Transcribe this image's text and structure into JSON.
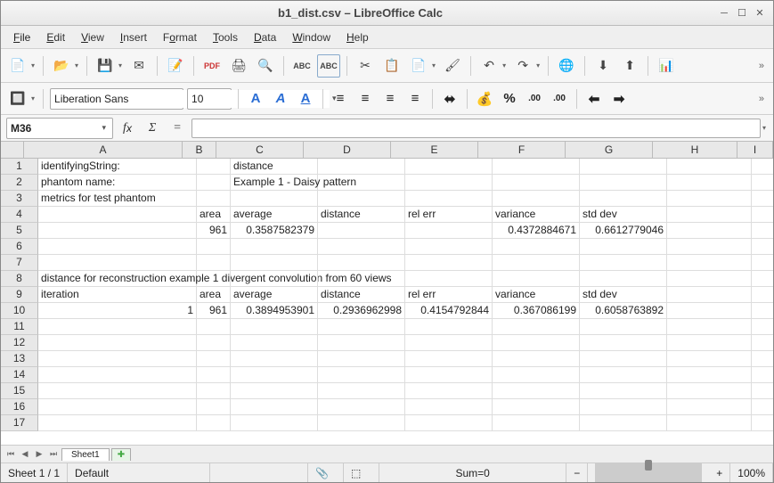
{
  "window": {
    "title": "b1_dist.csv – LibreOffice Calc"
  },
  "menu": {
    "file": "File",
    "edit": "Edit",
    "view": "View",
    "insert": "Insert",
    "format": "Format",
    "tools": "Tools",
    "data": "Data",
    "window": "Window",
    "help": "Help"
  },
  "font": {
    "name": "Liberation Sans",
    "size": "10"
  },
  "namebox": "M36",
  "columns": [
    "A",
    "B",
    "C",
    "D",
    "E",
    "F",
    "G",
    "H",
    "I"
  ],
  "rownums": [
    "1",
    "2",
    "3",
    "4",
    "5",
    "6",
    "7",
    "8",
    "9",
    "10",
    "11",
    "12",
    "13",
    "14",
    "15",
    "16",
    "17"
  ],
  "cells": {
    "A1": "identifyingString:",
    "C1": "distance",
    "A2": "phantom name:",
    "C2": "Example 1 - Daisy pattern",
    "A3": "metrics for test phantom",
    "B4": "area",
    "C4": "average",
    "D4": "distance",
    "E4": "rel err",
    "F4": "variance",
    "G4": "std dev",
    "B5": "961",
    "C5": "0.3587582379",
    "F5": "0.4372884671",
    "G5": "0.6612779046",
    "A8": "distance for reconstruction example 1 divergent convolution from 60 views",
    "A9": "iteration",
    "B9": "area",
    "C9": "average",
    "D9": "distance",
    "E9": "rel err",
    "F9": "variance",
    "G9": "std dev",
    "A10": "1",
    "B10": "961",
    "C10": "0.3894953901",
    "D10": "0.2936962998",
    "E10": "0.4154792844",
    "F10": "0.367086199",
    "G10": "0.6058763892"
  },
  "numeric": [
    "B5",
    "C5",
    "F5",
    "G5",
    "A10",
    "B10",
    "C10",
    "D10",
    "E10",
    "F10",
    "G10"
  ],
  "tabs": {
    "sheet": "Sheet1"
  },
  "status": {
    "sheet": "Sheet 1 / 1",
    "style": "Default",
    "sum": "Sum=0",
    "zoom": "100%"
  }
}
